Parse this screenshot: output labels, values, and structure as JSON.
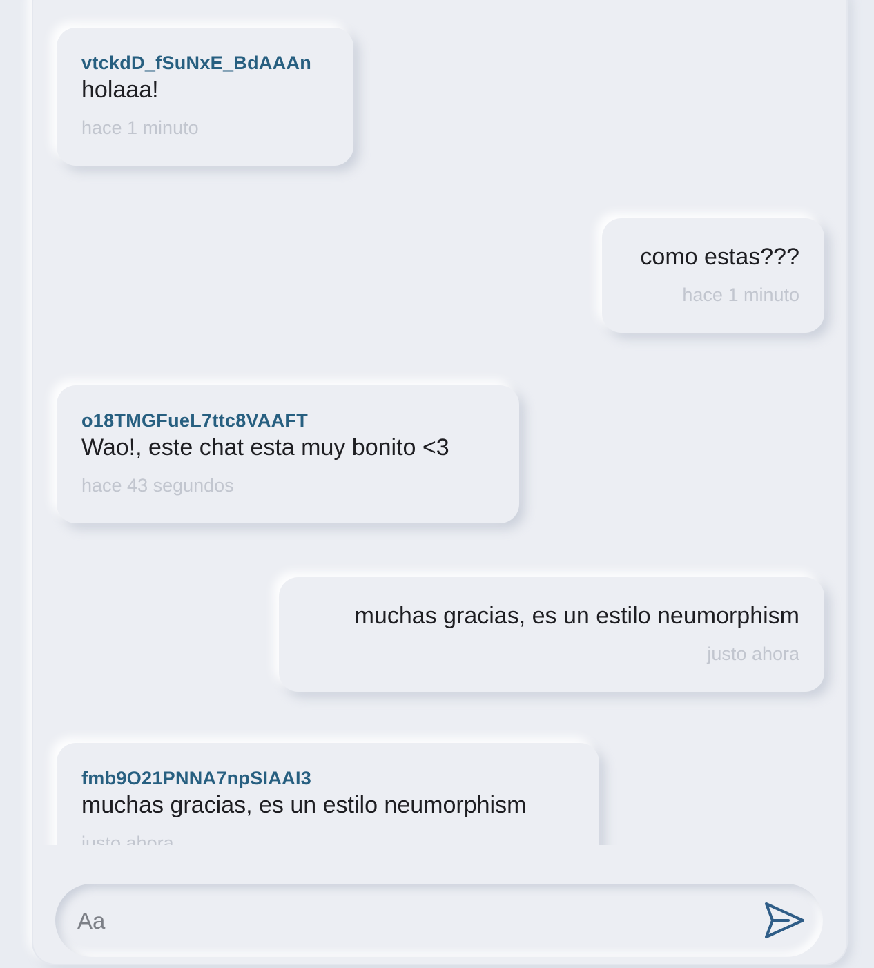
{
  "messages": [
    {
      "direction": "incoming",
      "sender": "vtckdD_fSuNxE_BdAAAn",
      "text": "holaaa!",
      "time": "hace 1 minuto"
    },
    {
      "direction": "outgoing",
      "sender": "",
      "text": "como estas???",
      "time": "hace 1 minuto"
    },
    {
      "direction": "incoming",
      "sender": "o18TMGFueL7ttc8VAAFT",
      "text": "Wao!, este chat esta muy bonito <3",
      "time": "hace 43 segundos"
    },
    {
      "direction": "outgoing",
      "sender": "",
      "text": "muchas gracias, es un estilo neumorphism",
      "time": "justo ahora"
    },
    {
      "direction": "incoming",
      "sender": "fmb9O21PNNA7npSIAAI3",
      "text": "muchas gracias, es un estilo neumorphism",
      "time": "justo ahora"
    }
  ],
  "composer": {
    "placeholder": "Aa",
    "value": "",
    "send_icon": "send-icon"
  },
  "colors": {
    "background": "#e9ecf2",
    "sender": "#275f80",
    "timestamp": "#c2c6cf",
    "send_icon": "#2f5d87"
  }
}
